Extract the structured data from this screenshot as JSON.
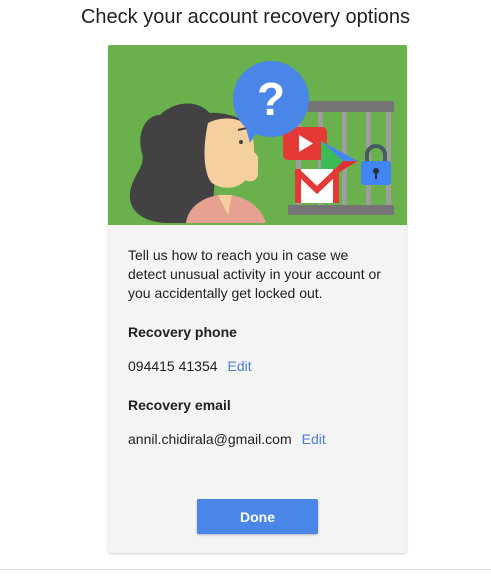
{
  "page": {
    "title": "Check your account recovery options"
  },
  "intro_text": "Tell us how to reach you in case we detect unusual activity in your account or you accidentally get locked out.",
  "recovery_phone": {
    "label": "Recovery phone",
    "value": "094415 41354",
    "edit_label": "Edit"
  },
  "recovery_email": {
    "label": "Recovery email",
    "value": "annil.chidirala@gmail.com",
    "edit_label": "Edit"
  },
  "done_label": "Done",
  "colors": {
    "illustration_bg": "#6ab04c",
    "primary_button": "#4a86e8",
    "link": "#4a7fd9"
  },
  "icons": [
    "question-mark-icon",
    "youtube-icon",
    "play-store-icon",
    "gmail-icon",
    "lock-icon"
  ]
}
